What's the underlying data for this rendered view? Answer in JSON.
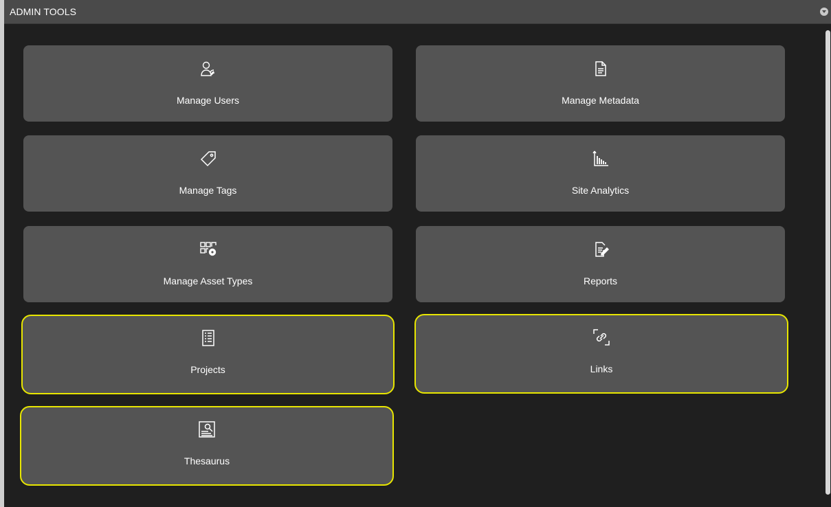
{
  "panel": {
    "title": "ADMIN TOOLS"
  },
  "colors": {
    "background": "#1f1f1f",
    "header": "#4a4a4a",
    "tile": "#545454",
    "highlight": "#e8e600",
    "text": "#ffffff"
  },
  "tiles": [
    {
      "label": "Manage Users",
      "icon": "users-icon",
      "highlighted": false
    },
    {
      "label": "Manage Metadata",
      "icon": "document-icon",
      "highlighted": false
    },
    {
      "label": "Manage Tags",
      "icon": "tag-icon",
      "highlighted": false
    },
    {
      "label": "Site Analytics",
      "icon": "bar-chart-icon",
      "highlighted": false
    },
    {
      "label": "Manage Asset Types",
      "icon": "grid-gear-icon",
      "highlighted": false
    },
    {
      "label": "Reports",
      "icon": "report-edit-icon",
      "highlighted": false
    },
    {
      "label": "Projects",
      "icon": "list-document-icon",
      "highlighted": true
    },
    {
      "label": "Links",
      "icon": "link-icon",
      "highlighted": true
    },
    {
      "label": "Thesaurus",
      "icon": "search-document-icon",
      "highlighted": true
    }
  ]
}
